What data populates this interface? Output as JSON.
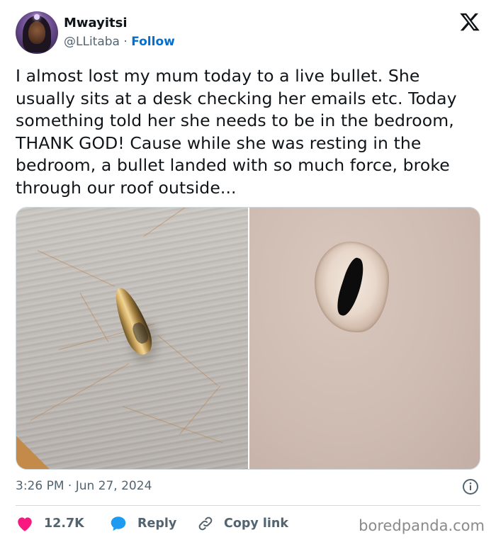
{
  "author": {
    "display_name": "Mwayitsi",
    "handle": "@LLitaba",
    "separator": " · ",
    "follow_label": "Follow"
  },
  "tweet": {
    "text": "I almost lost my mum today to a live bullet. She usually sits at a desk checking her emails etc. Today something told her she needs to be in the bedroom, THANK GOD! Cause while she was resting in the bedroom, a bullet landed with so much force, broke through our roof outside...",
    "timestamp": "3:26 PM · Jun 27, 2024"
  },
  "actions": {
    "like_count": "12.7K",
    "reply_label": "Reply",
    "copy_label": "Copy link"
  },
  "watermark": "boredpanda.com",
  "icons": {
    "logo": "x-logo-icon",
    "info": "info-icon",
    "like": "heart-icon",
    "reply": "reply-bubble-icon",
    "copy": "link-icon"
  },
  "colors": {
    "text": "#0f1419",
    "muted": "#536471",
    "link": "#006fd6",
    "like": "#f91880",
    "reply": "#1d9bf0",
    "border": "#cfd9de"
  }
}
